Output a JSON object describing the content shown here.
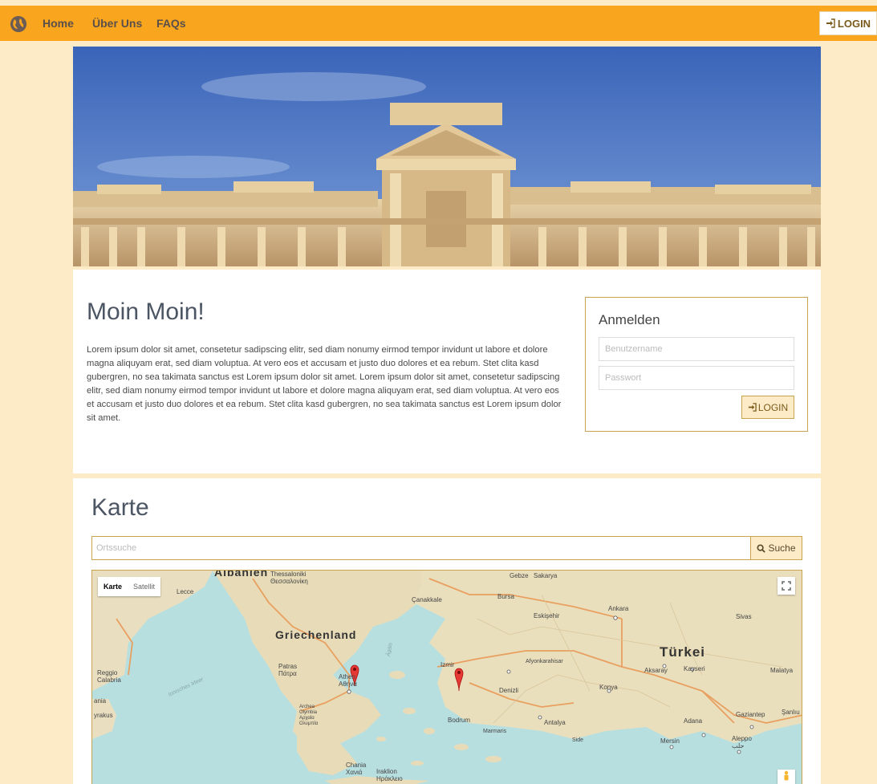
{
  "nav": {
    "items": [
      {
        "label": "Home"
      },
      {
        "label": "Über Uns"
      },
      {
        "label": "FAQs"
      }
    ],
    "login_label": "LOGIN"
  },
  "intro": {
    "title": "Moin Moin!",
    "text": "Lorem ipsum dolor sit amet, consetetur sadipscing elitr, sed diam nonumy eirmod tempor invidunt ut labore et dolore magna aliquyam erat, sed diam voluptua. At vero eos et accusam et justo duo dolores et ea rebum. Stet clita kasd gubergren, no sea takimata sanctus est Lorem ipsum dolor sit amet. Lorem ipsum dolor sit amet, consetetur sadipscing elitr, sed diam nonumy eirmod tempor invidunt ut labore et dolore magna aliquyam erat, sed diam voluptua. At vero eos et accusam et justo duo dolores et ea rebum. Stet clita kasd gubergren, no sea takimata sanctus est Lorem ipsum dolor sit amet."
  },
  "login_form": {
    "title": "Anmelden",
    "username_placeholder": "Benutzername",
    "password_placeholder": "Passwort",
    "submit_label": "LOGIN"
  },
  "map_section": {
    "title": "Karte",
    "search_placeholder": "Ortssuche",
    "search_button": "Suche",
    "map_types": [
      "Karte",
      "Satellit"
    ],
    "labels": {
      "albanien": "Albanien",
      "thessaloniki": "Thessaloniki Θεσσαλονίκη",
      "lecce": "Lecce",
      "canakkale": "Çanakkale",
      "bursa": "Bursa",
      "gebze": "Gebze",
      "sakarya": "Sakarya",
      "ankara": "Ankara",
      "eskisehir": "Eskişehir",
      "sivas": "Sivas",
      "griechenland": "Griechenland",
      "tuerkei": "Türkei",
      "reggio": "Reggio Calabria",
      "patras": "Patras Πάτρα",
      "athen": "Athen Αθήνα",
      "izmir": "Izmir",
      "afyon": "Afyonkarahisar",
      "aksaray": "Aksaray",
      "kayseri": "Kayseri",
      "malatya": "Malatya",
      "konya": "Konya",
      "denizli": "Denizli",
      "bodrum": "Bodrum",
      "marmaris": "Marmaris",
      "antalya": "Antalya",
      "side": "Side",
      "adana": "Adana",
      "gaziantep": "Gaziantep",
      "sanliurfa": "Şanlıu",
      "mersin": "Mersin",
      "aleppo": "Aleppo حلب",
      "catania": "ania",
      "syrakus": "yrakus",
      "archea": "Archea Olymbia Αρχαία Ολυμπία",
      "chania": "Chania Χανιά",
      "iraklion": "Iraklion Ηράκλειο",
      "ionian_sea": "Ionisches Meer",
      "aegean": "Ägäis"
    }
  },
  "colors": {
    "nav_bg": "#f9a61e",
    "page_bg": "#fdebc8",
    "accent_border": "#c9a44e",
    "heading": "#4c5563"
  }
}
